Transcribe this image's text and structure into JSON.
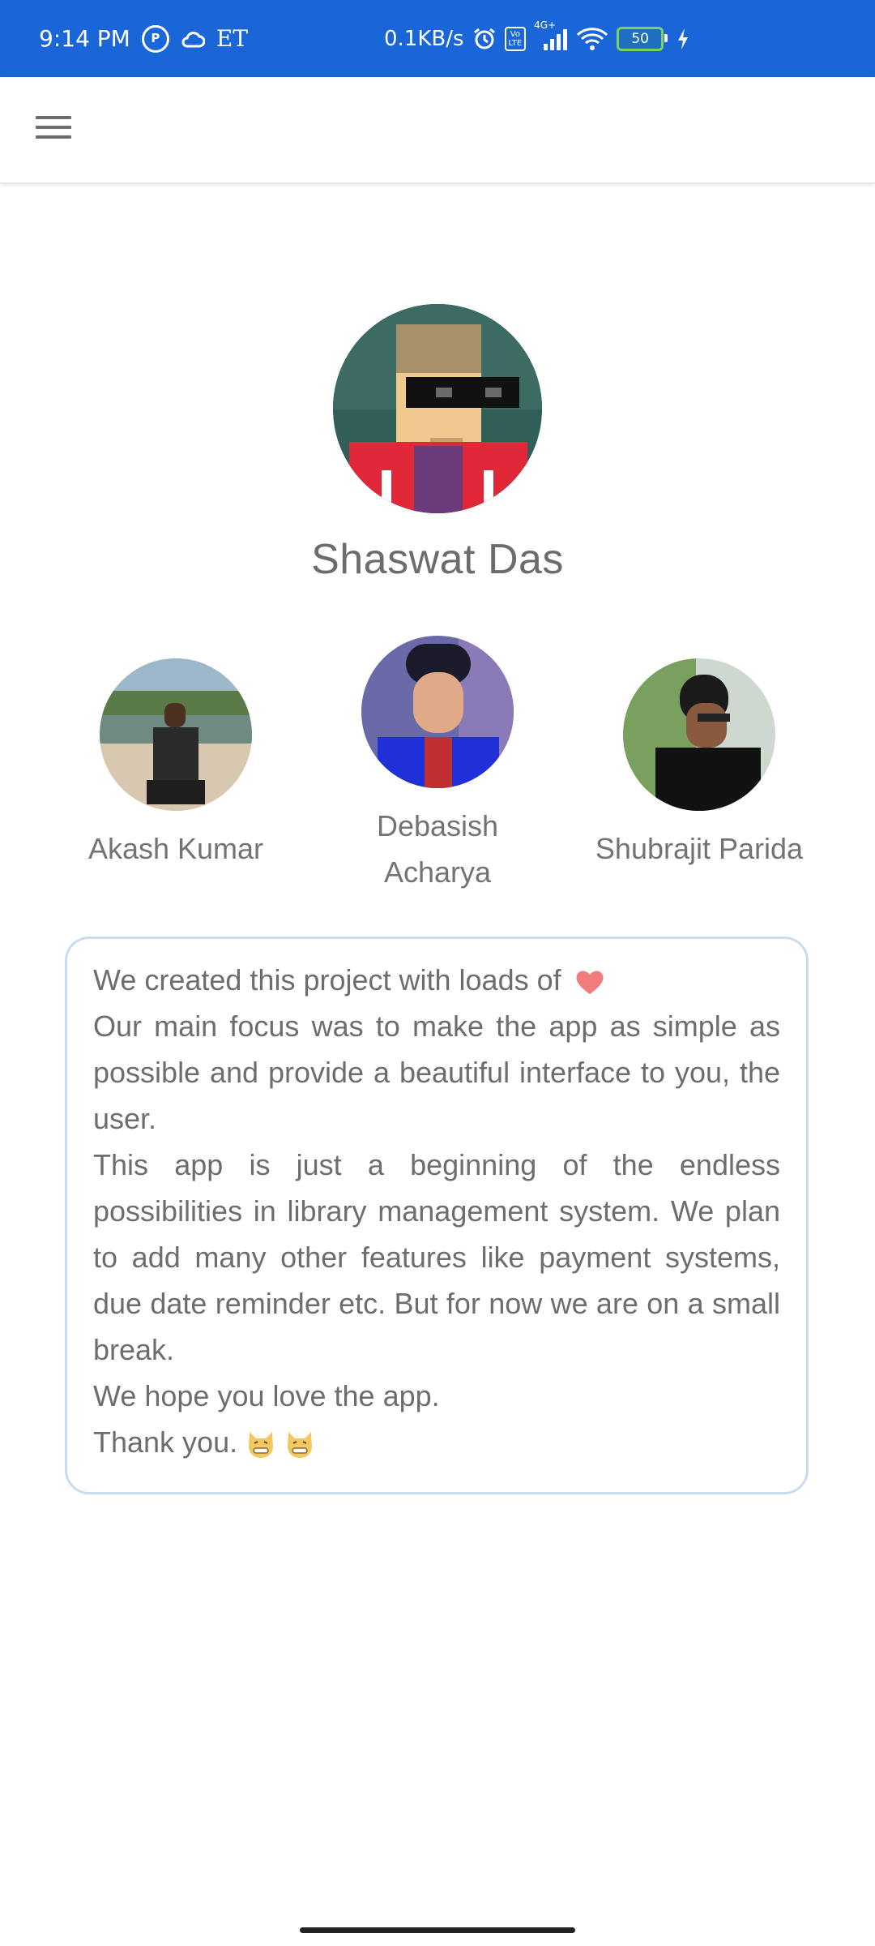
{
  "status_bar": {
    "time": "9:14 PM",
    "carrier": "ET",
    "network_speed": "0.1KB/s",
    "signal": "4G+",
    "battery": "50"
  },
  "app_bar": {
    "menu_icon": "hamburger-menu-icon"
  },
  "profile": {
    "name": "Shaswat Das"
  },
  "team": [
    {
      "name": "Akash Kumar"
    },
    {
      "name": "Debasish Acharya"
    },
    {
      "name": "Shubrajit Parida"
    }
  ],
  "about": {
    "line1": "We created this project with loads of",
    "line2": "Our main focus was to make the app as simple as possible and provide a beautiful interface to you, the user.",
    "line3": "This app is just a beginning of the endless possibilities in library management system. We plan to add many other features like payment systems, due date reminder etc. But for now we are on a small break.",
    "line4": "We hope you love the app.",
    "line5": "Thank you."
  },
  "colors": {
    "status_bar": "#1a66d9",
    "card_border": "#c8dcf0",
    "text": "#6d6d6d",
    "heart": "#f07c7c"
  }
}
